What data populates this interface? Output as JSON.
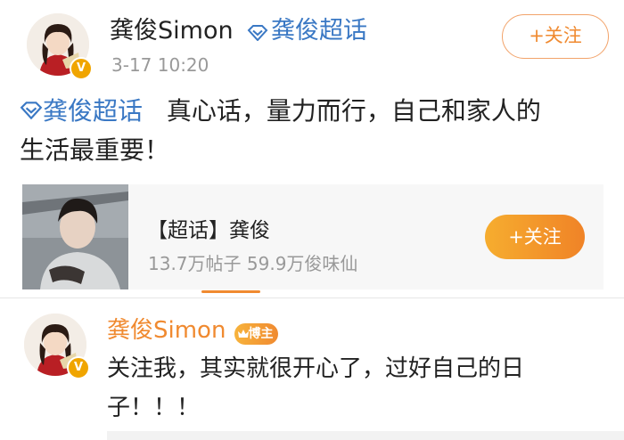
{
  "post": {
    "author": "龚俊Simon",
    "supertopic_tag": "龚俊超话",
    "time": "3-17 10:20",
    "follow_label": "+关注",
    "text_link": "龚俊超话",
    "text_line1": "真心话，量力而行，自己和家人的",
    "text_line2": "生活最重要！"
  },
  "card": {
    "title": "【超话】龚俊",
    "stats": "13.7万帖子  59.9万俊味仙",
    "follow_label": "+关注"
  },
  "comment": {
    "author": "龚俊Simon",
    "badge": "博主",
    "line1": "关注我，其实就很开心了，过好自己的日",
    "line2": "子！！！"
  },
  "colors": {
    "link_blue": "#3a78c4",
    "accent_orange": "#f08a30",
    "verified_gold": "#f0a500"
  },
  "icons": {
    "verified_badge": "V",
    "supertopic_icon": "diamond-icon"
  }
}
